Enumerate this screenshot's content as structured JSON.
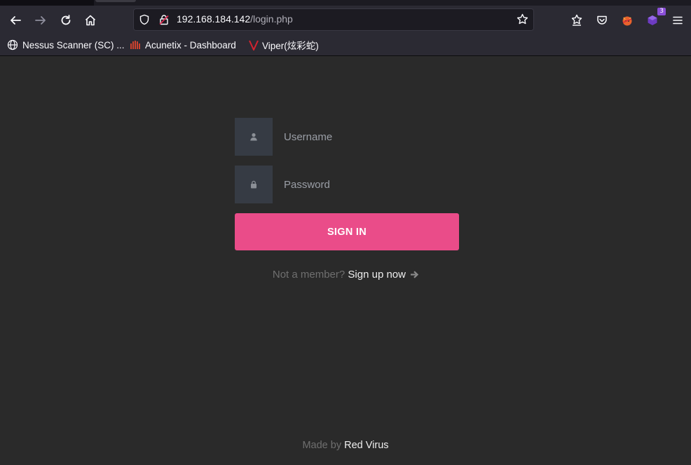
{
  "browser": {
    "url_host": "192.168.184.142",
    "url_path": "/login.php",
    "extension_badge": "3"
  },
  "bookmarks": [
    {
      "label": "Nessus Scanner (SC) ..."
    },
    {
      "label": "Acunetix - Dashboard"
    },
    {
      "label": "Viper(炫彩蛇)"
    }
  ],
  "login": {
    "username_placeholder": "Username",
    "password_placeholder": "Password",
    "signin_label": "SIGN IN",
    "member_text": "Not a member?",
    "signup_label": "Sign up now",
    "footer_prefix": "Made by",
    "footer_brand": "Red Virus"
  },
  "colors": {
    "accent": "#ea4c89",
    "page_bg": "#2a2a2a",
    "addon_bg": "#363b44"
  }
}
